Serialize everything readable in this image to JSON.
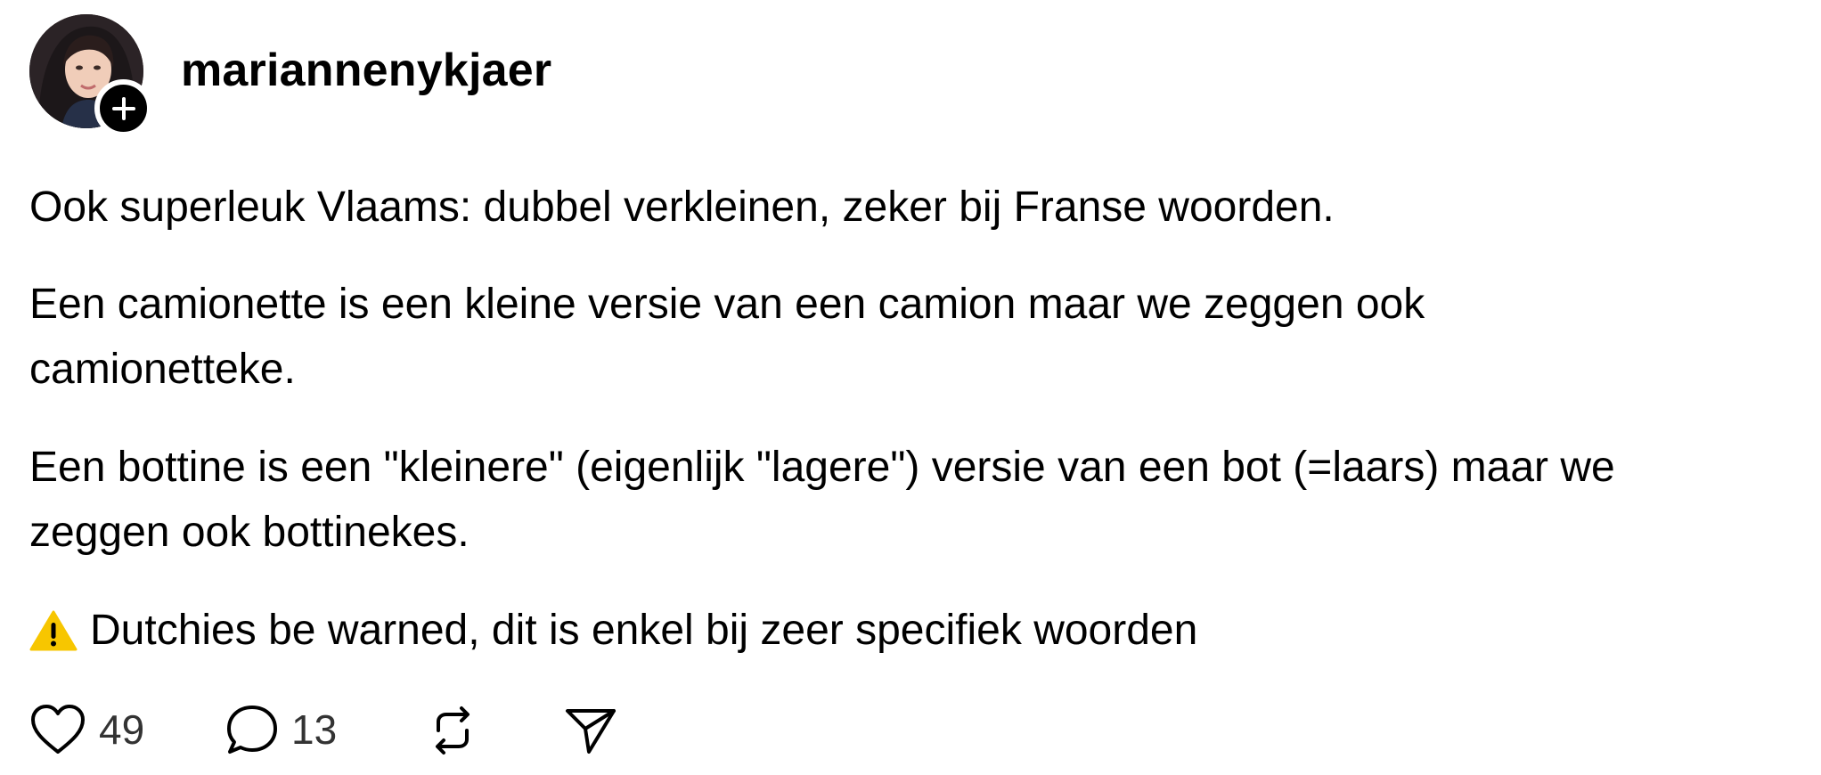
{
  "post": {
    "username": "mariannenykjaer",
    "paragraphs": {
      "p1": "Ook superleuk Vlaams: dubbel verkleinen, zeker bij Franse woorden.",
      "p2_line1": "Een camionette is een kleine versie van een camion maar we zeggen ook",
      "p2_line2": "camionetteke.",
      "p3_line1": "Een bottine is een \"kleinere\" (eigenlijk \"lagere\") versie van een bot (=laars) maar we",
      "p3_line2": "zeggen ook bottinekes.",
      "p4": "Dutchies be warned, dit is enkel bij zeer specifiek woorden"
    },
    "icons": {
      "avatar": "avatar",
      "follow": "plus-icon",
      "warning": "warning-icon",
      "like": "heart-icon",
      "reply": "comment-icon",
      "repost": "repost-icon",
      "share": "send-icon"
    },
    "actions": {
      "likes": "49",
      "replies": "13"
    },
    "colors": {
      "text": "#000000",
      "muted": "#333333",
      "warning": "#F7C600"
    }
  }
}
